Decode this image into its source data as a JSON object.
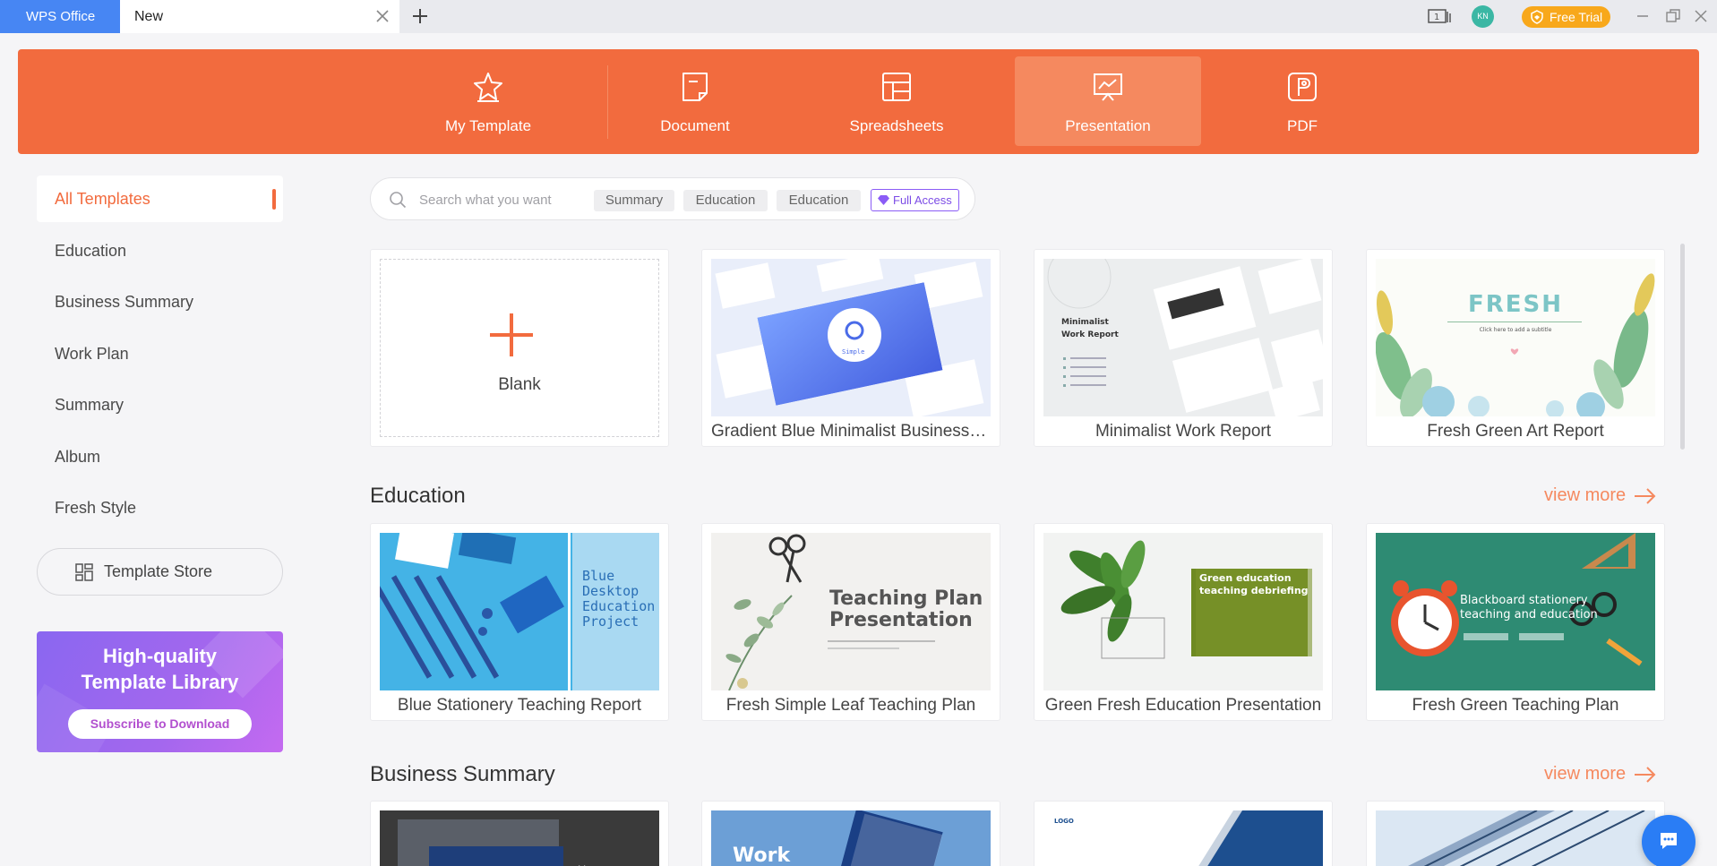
{
  "titlebar": {
    "app_tab": "WPS Office",
    "doc_tab": "New",
    "avatar_initials": "KN",
    "free_trial": "Free Trial"
  },
  "hero": {
    "tabs": [
      {
        "label": "My Template",
        "icon": "star-icon"
      },
      {
        "label": "Document",
        "icon": "document-icon"
      },
      {
        "label": "Spreadsheets",
        "icon": "spreadsheet-icon"
      },
      {
        "label": "Presentation",
        "icon": "presentation-icon",
        "active": true
      },
      {
        "label": "PDF",
        "icon": "pdf-icon"
      }
    ],
    "color": "#f26b3e"
  },
  "sidebar": {
    "items": [
      {
        "label": "All Templates",
        "active": true
      },
      {
        "label": "Education"
      },
      {
        "label": "Business Summary"
      },
      {
        "label": "Work Plan"
      },
      {
        "label": "Summary"
      },
      {
        "label": "Album"
      },
      {
        "label": "Fresh Style"
      }
    ],
    "store_label": "Template Store",
    "promo": {
      "line1": "High-quality",
      "line2": "Template Library",
      "button": "Subscribe to Download"
    }
  },
  "search": {
    "placeholder": "Search what you want",
    "chips": [
      "Summary",
      "Education",
      "Education"
    ],
    "full_access": "Full Access"
  },
  "top_row": {
    "blank_label": "Blank",
    "cards": [
      {
        "title": "Gradient Blue Minimalist Business T...",
        "thumb_text": "Simple"
      },
      {
        "title": "Minimalist Work Report",
        "thumb_text": [
          "Minimalist",
          "Work Report"
        ]
      },
      {
        "title": "Fresh Green Art Report",
        "thumb_text": [
          "FRESH",
          "Click here to add a subtitle"
        ]
      }
    ]
  },
  "education": {
    "title": "Education",
    "view_more": "view more",
    "cards": [
      {
        "title": "Blue Stationery Teaching Report",
        "thumb_text": [
          "Blue",
          "Desktop",
          "Education",
          "Project"
        ]
      },
      {
        "title": "Fresh Simple Leaf Teaching Plan",
        "thumb_text": [
          "Teaching Plan",
          "Presentation"
        ]
      },
      {
        "title": "Green Fresh Education Presentation",
        "thumb_text": [
          "Green education",
          "teaching debriefing"
        ]
      },
      {
        "title": "Fresh Green Teaching Plan",
        "thumb_text": [
          "Blackboard stationery",
          "teaching and education"
        ]
      }
    ]
  },
  "business": {
    "title": "Business Summary",
    "view_more": "view more",
    "thumb_text": [
      "Work",
      "LOGO"
    ]
  }
}
